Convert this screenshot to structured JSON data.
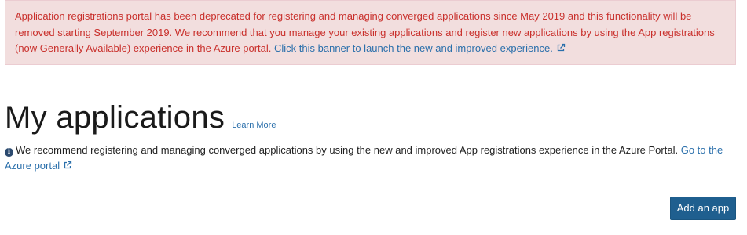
{
  "banner": {
    "text": "Application registrations portal has been deprecated for registering and managing converged applications since May 2019 and this functionality will be removed starting September 2019. We recommend that you manage your existing applications and register new applications by using the App registrations (now Generally Available) experience in the Azure portal.",
    "link_text": "Click this banner to launch the new and improved experience.",
    "icon": "external-link-icon"
  },
  "header": {
    "title": "My applications",
    "learn_more": "Learn More"
  },
  "info": {
    "icon": "info-icon",
    "text": "We recommend registering and managing converged applications by using the new and improved App registrations experience in the Azure Portal.",
    "link_text": "Go to the Azure portal",
    "link_icon": "external-link-icon"
  },
  "actions": {
    "add_app_label": "Add an app"
  },
  "colors": {
    "banner_bg": "#f2dede",
    "banner_text": "#c9302c",
    "link": "#2a6fab",
    "button_bg": "#1f5f8f"
  }
}
